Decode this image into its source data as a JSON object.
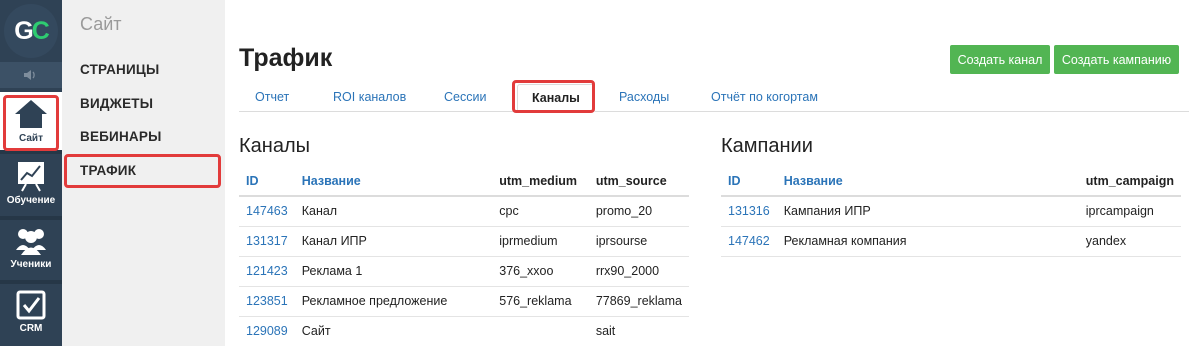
{
  "logo": {
    "g": "G",
    "c": "C"
  },
  "rail": {
    "items": [
      {
        "label": "Сайт"
      },
      {
        "label": "Обучение"
      },
      {
        "label": "Ученики"
      },
      {
        "label": "CRM"
      }
    ]
  },
  "submenu": {
    "title": "Сайт",
    "items": [
      "СТРАНИЦЫ",
      "ВИДЖЕТЫ",
      "ВЕБИНАРЫ",
      "ТРАФИК"
    ]
  },
  "header": {
    "title": "Трафик",
    "create_channel": "Создать канал",
    "create_campaign": "Создать кампанию"
  },
  "tabs": [
    "Отчет",
    "ROI каналов",
    "Сессии",
    "Каналы",
    "Расходы",
    "Отчёт по когортам"
  ],
  "channels": {
    "title": "Каналы",
    "columns": [
      "ID",
      "Название",
      "utm_medium",
      "utm_source"
    ],
    "rows": [
      [
        "147463",
        "Канал",
        "cpc",
        "promo_20"
      ],
      [
        "131317",
        "Канал ИПР",
        "iprmedium",
        "iprsourse"
      ],
      [
        "121423",
        "Реклама 1",
        "376_xxoo",
        "rrx90_2000"
      ],
      [
        "123851",
        "Рекламное предложение",
        "576_reklama",
        "77869_reklama"
      ],
      [
        "129089",
        "Сайт",
        "",
        "sait"
      ]
    ]
  },
  "campaigns": {
    "title": "Кампании",
    "columns": [
      "ID",
      "Название",
      "utm_campaign"
    ],
    "rows": [
      [
        "131316",
        "Кампания ИПР",
        "iprcampaign"
      ],
      [
        "147462",
        "Рекламная компания",
        "yandex"
      ]
    ]
  },
  "colors": {
    "accent": "#2b74b8",
    "rail": "#2f4255",
    "button": "#52b553",
    "highlight": "#e23b3b"
  }
}
